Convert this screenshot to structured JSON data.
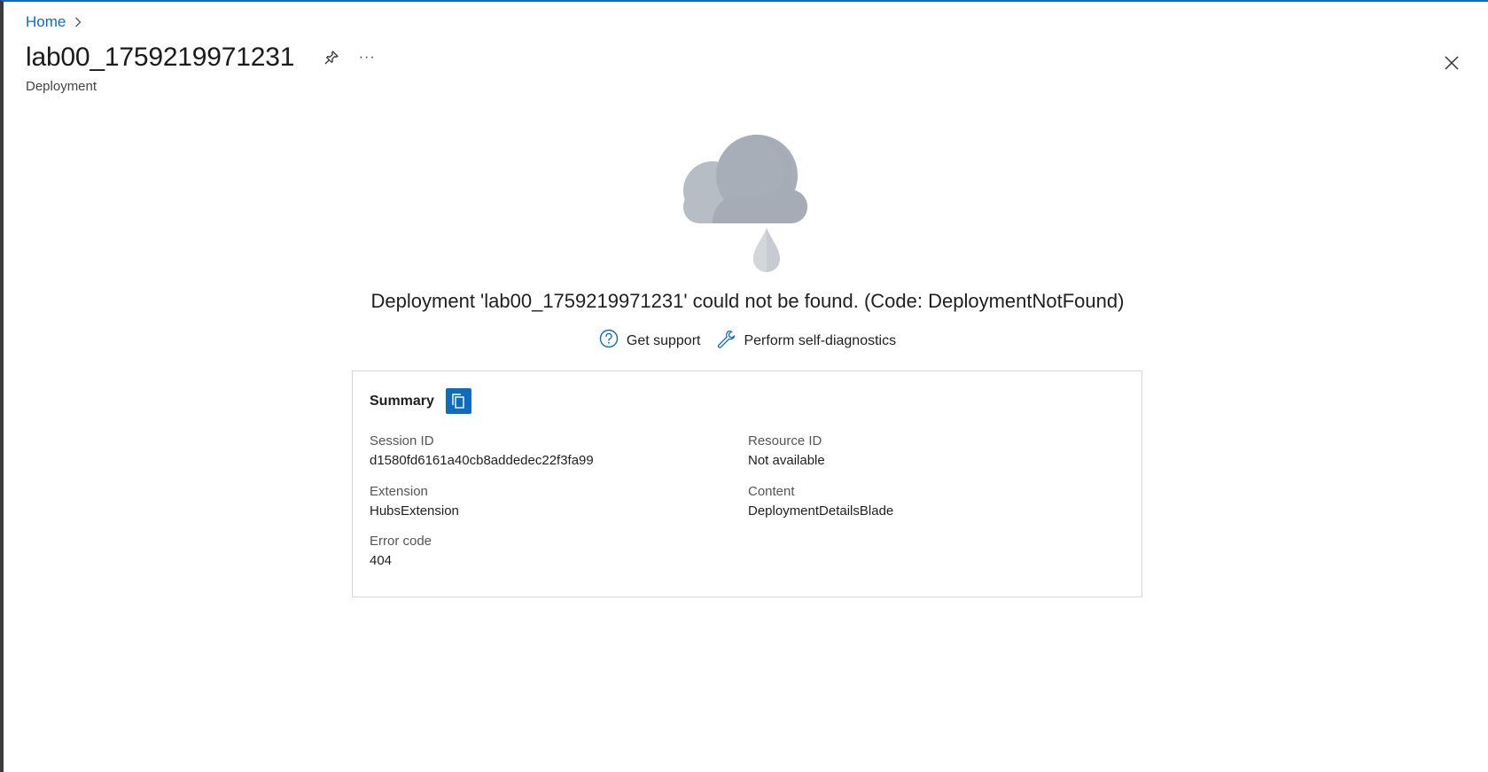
{
  "breadcrumb": {
    "home_label": "Home"
  },
  "header": {
    "title": "lab00_1759219971231",
    "subtitle": "Deployment",
    "more_label": "···"
  },
  "error": {
    "message": "Deployment 'lab00_1759219971231' could not be found. (Code: DeploymentNotFound)"
  },
  "actions": {
    "support_label": "Get support",
    "diagnostics_label": "Perform self-diagnostics"
  },
  "summary": {
    "title": "Summary",
    "session_id_label": "Session ID",
    "session_id_value": "d1580fd6161a40cb8addedec22f3fa99",
    "resource_id_label": "Resource ID",
    "resource_id_value": "Not available",
    "extension_label": "Extension",
    "extension_value": "HubsExtension",
    "content_label": "Content",
    "content_value": "DeploymentDetailsBlade",
    "error_code_label": "Error code",
    "error_code_value": "404"
  },
  "colors": {
    "accent": "#0f6cbd",
    "cloud_light": "#b7bdc4",
    "cloud_dark": "#a5acb5"
  }
}
